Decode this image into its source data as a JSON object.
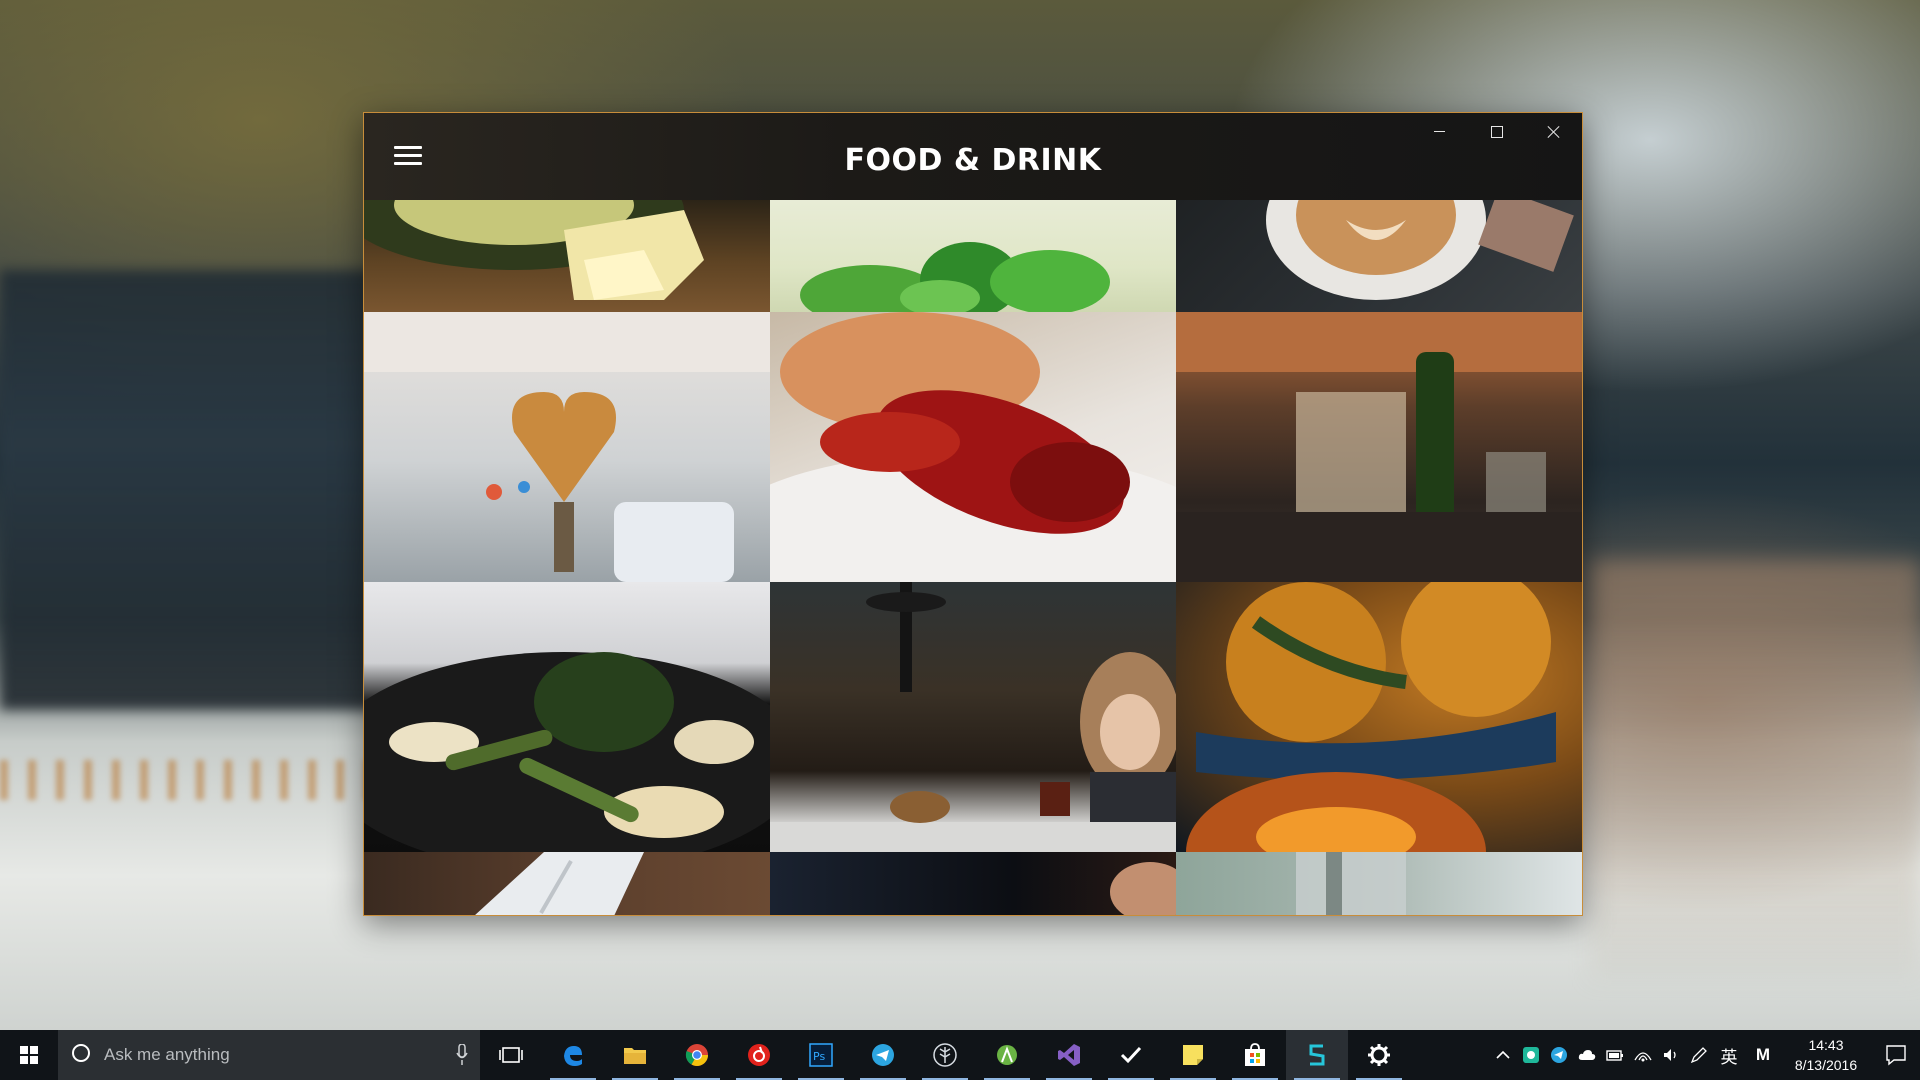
{
  "app": {
    "title": "FOOD & DRINK",
    "border_color": "#c88d3a"
  },
  "window_controls": {
    "minimize_icon": "minimize-icon",
    "maximize_icon": "maximize-icon",
    "close_icon": "close-icon"
  },
  "photos": [
    {
      "subject": "avocado and cheese"
    },
    {
      "subject": "mint leaves"
    },
    {
      "subject": "latte art coffee"
    },
    {
      "subject": "heart-shaped waffle"
    },
    {
      "subject": "crayfish and shrimp"
    },
    {
      "subject": "restaurant interior with wine bottle"
    },
    {
      "subject": "grilled vegetables"
    },
    {
      "subject": "woman at cafe table"
    },
    {
      "subject": "oranges and tea"
    },
    {
      "subject": "fork on napkin"
    },
    {
      "subject": "dark table"
    },
    {
      "subject": "glass"
    }
  ],
  "taskbar": {
    "search_placeholder": "Ask me anything",
    "apps": [
      {
        "name": "task-view-icon",
        "running": false
      },
      {
        "name": "edge-icon",
        "running": true
      },
      {
        "name": "file-explorer-icon",
        "running": true
      },
      {
        "name": "chrome-icon",
        "running": true
      },
      {
        "name": "netease-music-icon",
        "running": true
      },
      {
        "name": "photoshop-icon",
        "running": true
      },
      {
        "name": "telegram-icon",
        "running": true
      },
      {
        "name": "evernote-icon",
        "running": true
      },
      {
        "name": "android-studio-icon",
        "running": true
      },
      {
        "name": "visual-studio-icon",
        "running": true
      },
      {
        "name": "todo-icon",
        "running": true
      },
      {
        "name": "sticky-notes-icon",
        "running": true
      },
      {
        "name": "store-icon",
        "running": true
      },
      {
        "name": "splash-app-icon",
        "running": true,
        "active": true
      },
      {
        "name": "settings-icon",
        "running": true
      }
    ],
    "ime": "英",
    "ime2": "M",
    "time": "14:43",
    "date": "8/13/2016"
  }
}
